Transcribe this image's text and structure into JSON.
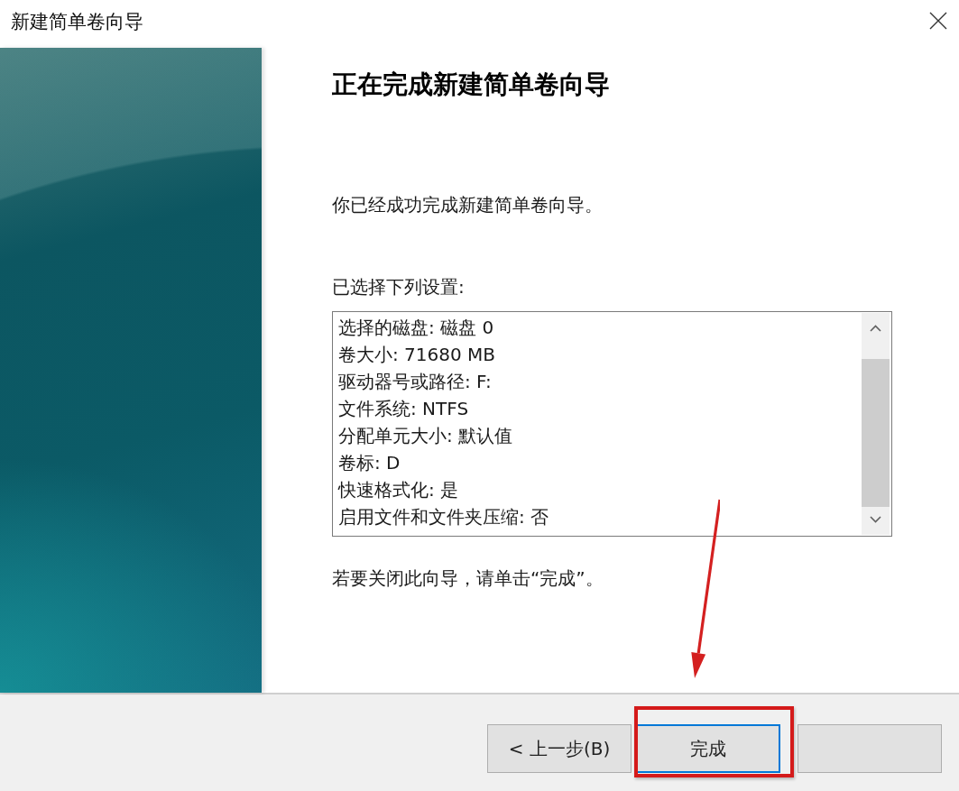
{
  "window": {
    "title": "新建简单卷向导"
  },
  "page": {
    "heading": "正在完成新建简单卷向导",
    "message": "你已经成功完成新建简单卷向导。",
    "settings_label": "已选择下列设置:",
    "settings": [
      "选择的磁盘: 磁盘 0",
      "卷大小: 71680 MB",
      "驱动器号或路径: F:",
      "文件系统: NTFS",
      "分配单元大小: 默认值",
      "卷标: D",
      "快速格式化: 是",
      "启用文件和文件夹压缩: 否"
    ],
    "closing_note": "若要关闭此向导，请单击“完成”。"
  },
  "buttons": [
    {
      "label": "< 上一步(B)",
      "default": false
    },
    {
      "label": "完成",
      "default": true
    },
    {
      "default": false
    }
  ],
  "annotations": [
    {
      "kind": "arrow"
    },
    {
      "kind": "frame"
    }
  ]
}
